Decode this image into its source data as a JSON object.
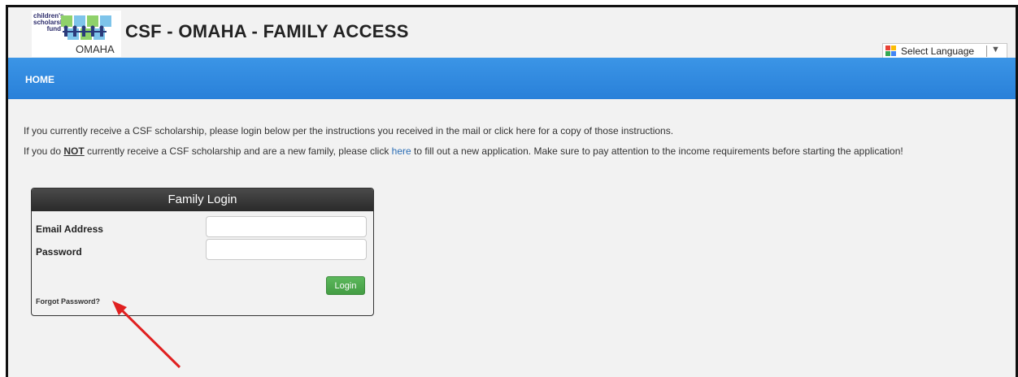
{
  "header": {
    "logo": {
      "small_text": "children's\nscholarship\nfund",
      "city": "OMAHA"
    },
    "title": "CSF - OMAHA - FAMILY ACCESS",
    "language": {
      "label": "Select Language",
      "arrow": "▼",
      "icon": "google-translate-icon"
    }
  },
  "nav": {
    "home": "HOME"
  },
  "info": {
    "line1": "If you currently receive a CSF scholarship, please login below per the instructions you received in the mail or click here for a copy of those instructions.",
    "line2_pre": "If you do ",
    "line2_not": "NOT",
    "line2_mid": " currently receive a CSF scholarship and are a new family, please click ",
    "line2_link": "here",
    "line2_post": " to fill out a new application. Make sure to pay attention to the income requirements before starting the application!"
  },
  "login": {
    "title": "Family Login",
    "email_label": "Email Address",
    "email_value": "",
    "password_label": "Password",
    "password_value": "",
    "button": "Login",
    "forgot": "Forgot Password?"
  },
  "colors": {
    "nav_blue": "#2f89df",
    "link": "#2a6db5",
    "login_green": "#4cae4c",
    "annotation_arrow": "#e02020"
  }
}
